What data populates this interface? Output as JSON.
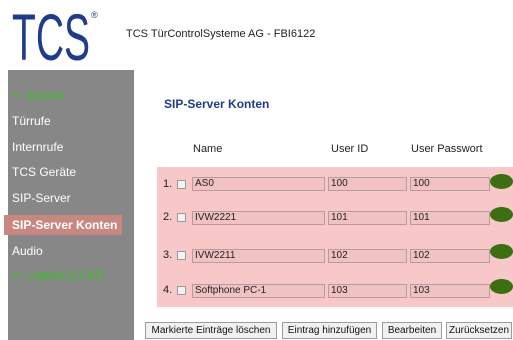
{
  "header": {
    "logo_text": "TCS",
    "title": "TCS TürControlSysteme AG - FBI6122"
  },
  "sidebar": {
    "items": [
      {
        "label": "<- Zurück"
      },
      {
        "label": "Türrufe"
      },
      {
        "label": "Internrufe"
      },
      {
        "label": "TCS Geräte"
      },
      {
        "label": "SIP-Server"
      },
      {
        "label": "SIP-Server Konten"
      },
      {
        "label": "Audio"
      },
      {
        "label": "<- Logout (13:41)"
      }
    ],
    "active": "SIP-Server Konten"
  },
  "main": {
    "section_title": "SIP-Server Konten",
    "columns": [
      "Name",
      "User ID",
      "User Passwort"
    ],
    "rows": [
      {
        "number": "1.",
        "name": "AS0",
        "user_id": "100",
        "password": "100",
        "status_color": "#3d6f12"
      },
      {
        "number": "2.",
        "name": "IVW2221",
        "user_id": "101",
        "password": "101",
        "status_color": "#3d6f12"
      },
      {
        "number": "3.",
        "name": "IVW2211",
        "user_id": "102",
        "password": "102",
        "status_color": "#3d6f12"
      },
      {
        "number": "4.",
        "name": "Softphone PC-1",
        "user_id": "103",
        "password": "103",
        "status_color": "#3d6f12"
      }
    ]
  },
  "buttons": {
    "delete_marked": "Markierte Einträge löschen",
    "add_entry": "Eintrag hinzufügen",
    "edit": "Bearbeiten",
    "reset": "Zurücksetzen"
  },
  "colors": {
    "brand_blue": "#1f3b8c",
    "sidebar_bg": "#878787",
    "active_item_bg": "#c8877f",
    "link_green": "#35c21a",
    "table_bg": "#f8c7c7"
  }
}
